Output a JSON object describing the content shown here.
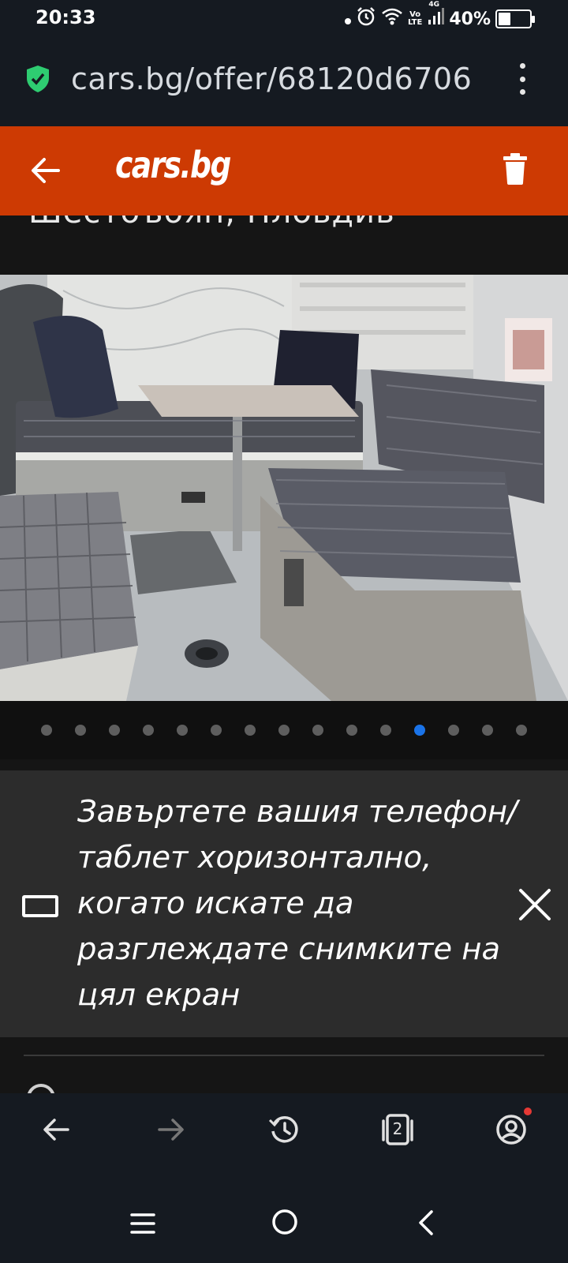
{
  "status_bar": {
    "time": "20:33",
    "network_top": "Vo",
    "network_bottom": "LTE",
    "network_gen": "4G",
    "battery": "40%",
    "battery_level": 0.4
  },
  "browser": {
    "url": "cars.bg/offer/68120d6706",
    "menu_icon": "more-vert-icon",
    "secure_icon": "shield-check-icon",
    "secure_color": "#2ecc71"
  },
  "site_header": {
    "brand": "cars.bg",
    "background": "#cd3a03",
    "back_icon": "arrow-left-icon",
    "delete_icon": "trash-icon"
  },
  "listing": {
    "title_partial": "Шестоъбян, Пловдив"
  },
  "gallery": {
    "total": 15,
    "active_index": 11,
    "active_color": "#1a73e8"
  },
  "hint": {
    "text": "Завъртете вашия телефон/таблет хоризонтално, когато искате да разглеждате снимките на цял екран",
    "icon": "landscape-phone-icon",
    "close_icon": "close-icon"
  },
  "toolbar": {
    "tab_count": "2",
    "items": [
      "back-icon",
      "forward-icon",
      "history-icon",
      "tabs-icon",
      "account-icon"
    ]
  },
  "system_nav": [
    "menu-icon",
    "home-icon",
    "back-icon"
  ]
}
